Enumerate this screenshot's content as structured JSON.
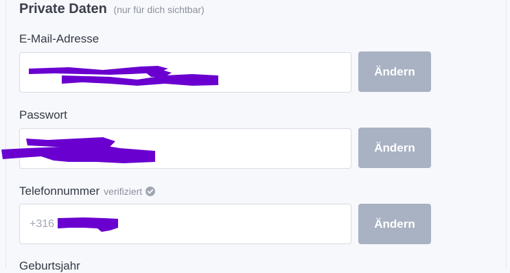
{
  "section": {
    "title": "Private Daten",
    "note": "(nur für dich sichtbar)"
  },
  "fields": {
    "email": {
      "label": "E-Mail-Adresse",
      "value": "",
      "button_label": "Ändern"
    },
    "password": {
      "label": "Passwort",
      "value": "",
      "button_label": "Ändern"
    },
    "phone": {
      "label": "Telefonnummer",
      "status": "verifiziert",
      "value": "+316",
      "button_label": "Ändern"
    },
    "birthyear": {
      "label": "Geburtsjahr"
    }
  },
  "colors": {
    "redaction": "#6a00d0",
    "button": "#a9b2c3",
    "verified_icon": "#a1a7b2"
  },
  "icons": {
    "verified": "check-circle-icon"
  }
}
